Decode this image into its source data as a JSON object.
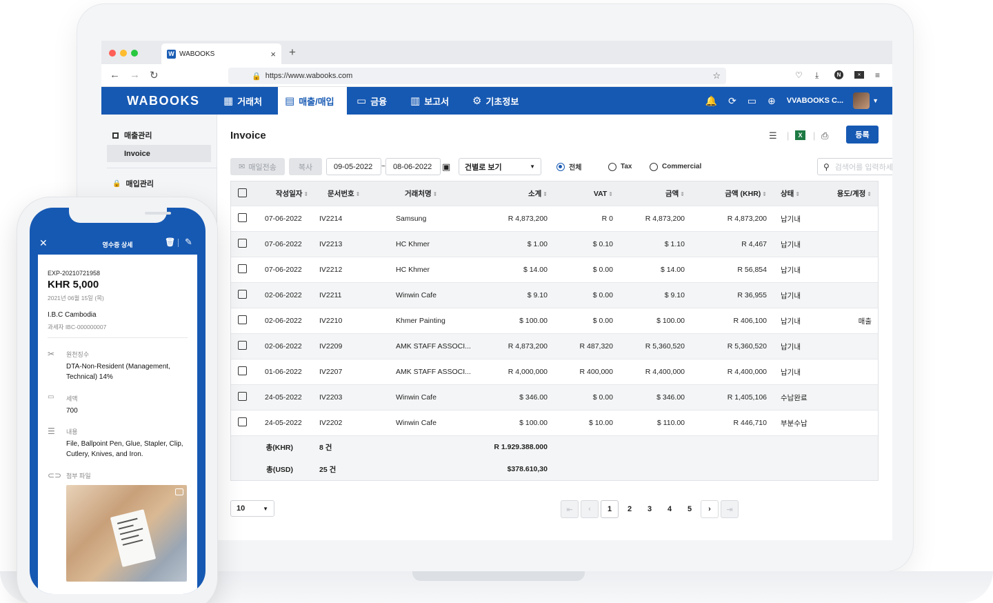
{
  "browser": {
    "tab_title": "WABOOKS",
    "tab_logo": "W",
    "new_tab": "+",
    "url": "https://www.wabooks.com"
  },
  "app": {
    "brand": "WABOOKS",
    "menu": [
      {
        "label": "거래처",
        "icon": "building-icon"
      },
      {
        "label": "매출/매입",
        "icon": "invoice-icon"
      },
      {
        "label": "금융",
        "icon": "card-icon"
      },
      {
        "label": "보고서",
        "icon": "chart-icon"
      },
      {
        "label": "기초정보",
        "icon": "gear-icon"
      }
    ],
    "company": "VVABOOKS C...",
    "accent": "#1659b3"
  },
  "sidebar": {
    "sections": [
      {
        "label": "매출관리",
        "items": [
          "Invoice"
        ]
      },
      {
        "label": "매입관리",
        "items": []
      }
    ]
  },
  "main": {
    "title": "Invoice",
    "register_label": "등록",
    "filters": {
      "send_email": "매일전송",
      "copy": "복사",
      "date_from": "09-05-2022",
      "date_sep": "~",
      "date_to": "08-06-2022",
      "view_mode": "건별로 보기",
      "radio_all": "전체",
      "radio_tax": "Tax",
      "radio_commercial": "Commercial",
      "search_placeholder": "검색어를 입력하세요."
    },
    "table": {
      "headers": [
        "작성일자",
        "문서번호",
        "거래처명",
        "소계",
        "VAT",
        "금액",
        "금액 (KHR)",
        "상태",
        "용도/계정"
      ],
      "rows": [
        [
          "07-06-2022",
          "IV2214",
          "Samsung",
          "R 4,873,200",
          "R 0",
          "R 4,873,200",
          "R 4,873,200",
          "납기내",
          ""
        ],
        [
          "07-06-2022",
          "IV2213",
          "HC Khmer",
          "$ 1.00",
          "$ 0.10",
          "$ 1.10",
          "R 4,467",
          "납기내",
          ""
        ],
        [
          "07-06-2022",
          "IV2212",
          "HC Khmer",
          "$ 14.00",
          "$ 0.00",
          "$ 14.00",
          "R 56,854",
          "납기내",
          ""
        ],
        [
          "02-06-2022",
          "IV2211",
          "Winwin Cafe",
          "$ 9.10",
          "$ 0.00",
          "$ 9.10",
          "R 36,955",
          "납기내",
          ""
        ],
        [
          "02-06-2022",
          "IV2210",
          "Khmer Painting",
          "$ 100.00",
          "$ 0.00",
          "$ 100.00",
          "R 406,100",
          "납기내",
          "매출"
        ],
        [
          "02-06-2022",
          "IV2209",
          "AMK STAFF ASSOCI...",
          "R 4,873,200",
          "R 487,320",
          "R 5,360,520",
          "R 5,360,520",
          "납기내",
          ""
        ],
        [
          "01-06-2022",
          "IV2207",
          "AMK STAFF ASSOCI...",
          "R 4,000,000",
          "R 400,000",
          "R 4,400,000",
          "R 4,400,000",
          "납기내",
          ""
        ],
        [
          "24-05-2022",
          "IV2203",
          "Winwin Cafe",
          "$ 346.00",
          "$ 0.00",
          "$ 346.00",
          "R 1,405,106",
          "수납완료",
          ""
        ],
        [
          "24-05-2022",
          "IV2202",
          "Winwin Cafe",
          "$ 100.00",
          "$ 10.00",
          "$ 110.00",
          "R 446,710",
          "부분수납",
          ""
        ]
      ],
      "totals": [
        {
          "label": "총(KHR)",
          "count": "8 건",
          "value": "R 1.929.388.000"
        },
        {
          "label": "총(USD)",
          "count": "25 건",
          "value": "$378.610,30"
        }
      ]
    },
    "pagination": {
      "page_size": "10",
      "pages": [
        "1",
        "2",
        "3",
        "4",
        "5"
      ],
      "current": "1"
    }
  },
  "phone": {
    "header_title": "영수증 상세",
    "expense_id": "EXP-20210721958",
    "amount": "KHR 5,000",
    "date": "2021년 06월 15일 (목)",
    "company": "I.B.C Cambodia",
    "tax_id": "과세자 IBC-000000007",
    "fields": [
      {
        "label": "원천징수",
        "value": "DTA-Non-Resident (Management, Technical) 14%",
        "icon": "scissors-icon"
      },
      {
        "label": "세액",
        "value": "700",
        "icon": "tax-icon"
      },
      {
        "label": "내용",
        "value": "File, Ballpoint Pen, Glue, Stapler, Clip, Cutlery, Knives, and Iron.",
        "icon": "lines-icon"
      },
      {
        "label": "첨부 파일",
        "value": "",
        "icon": "attachment-icon"
      }
    ]
  }
}
